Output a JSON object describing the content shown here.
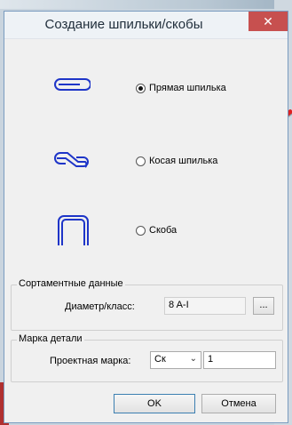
{
  "dialog": {
    "title": "Создание шпильки/скобы",
    "close_icon": "close-icon"
  },
  "options": [
    {
      "label": "Прямая шпилька",
      "selected": true,
      "icon": "straight-stud-icon"
    },
    {
      "label": "Косая шпилька",
      "selected": false,
      "icon": "oblique-stud-icon"
    },
    {
      "label": "Скоба",
      "selected": false,
      "icon": "bracket-icon"
    }
  ],
  "assortment": {
    "legend": "Сортаментные данные",
    "diameter_label": "Диаметр/класс:",
    "diameter_value": "8 A-I",
    "browse_label": "..."
  },
  "part_mark": {
    "legend": "Марка детали",
    "design_mark_label": "Проектная марка:",
    "prefix_value": "Ск",
    "number_value": "1"
  },
  "buttons": {
    "ok": "OK",
    "cancel": "Отмена"
  },
  "colors": {
    "icon_blue": "#1e35c8",
    "accent_red": "#e02020"
  }
}
